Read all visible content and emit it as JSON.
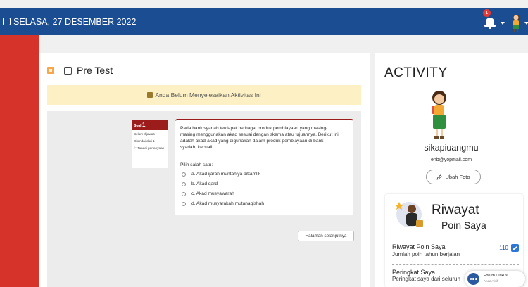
{
  "header": {
    "date": "SELASA, 27 DESEMBER 2022",
    "notification_count": "1"
  },
  "main": {
    "title": "Pre Test",
    "alert": "Anda Belum Menyelesaikan Aktivitas Ini",
    "question": {
      "label": "Soal",
      "number": "1",
      "status": "Belum dijawab",
      "score": "Ditandai dari 1",
      "flag": "Tandai pertanyaan",
      "text": "Pada bank syariah terdapat berbagai produk pembiayaan yang masing-masing menggunakan akad sesuai dengan skema atau tujuannya. Berikut ini adalah akad-akad yang digunakan dalam produk pembiayaan di bank syariah, kecuali ....",
      "prompt": "Pilih salah satu:",
      "options": [
        "a. Akad ijarah muntahiya bittamlik",
        "b. Akad qard",
        "c. Akad musyawarah",
        "d. Akad musyarakah mutanaqishah"
      ]
    },
    "next_label": "Halaman selanjutnya"
  },
  "activity": {
    "title": "ACTIVITY",
    "username": "sikapiuangmu",
    "email": "enb@yopmail.com",
    "edit_photo_label": "Ubah Foto",
    "points_title": "Riwayat",
    "points_subtitle": "Poin Saya",
    "history_label": "Riwayat Poin Saya",
    "history_sub": "Jumlah poin tahun berjalan",
    "history_value": "110",
    "rank_label": "Peringkat Saya",
    "rank_sub": "Peringkat saya dari seluruh"
  },
  "forum": {
    "title": "Forum Diskusi",
    "subtitle": "Anda Aktif"
  },
  "colors": {
    "header_bg": "#1a4d91",
    "accent_red": "#d6332b",
    "question_accent": "#9c1c1c",
    "warning_bg": "#fcf0c4"
  }
}
